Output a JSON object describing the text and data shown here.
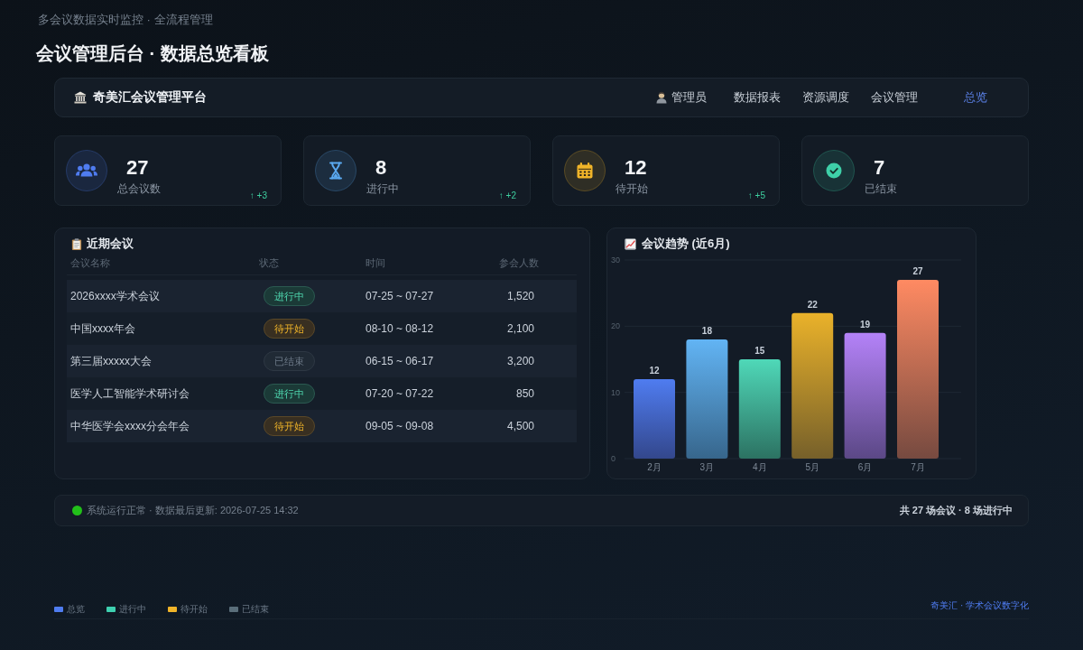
{
  "header": {
    "subtitle": "多会议数据实时监控 · 全流程管理",
    "title": "会议管理后台 · 数据总览看板"
  },
  "navbar": {
    "brand": "奇美汇会议管理平台",
    "items": [
      {
        "label": "管理员",
        "kind": "user",
        "selected": false
      },
      {
        "label": "数据报表",
        "kind": "link",
        "selected": false
      },
      {
        "label": "资源调度",
        "kind": "link",
        "selected": false
      },
      {
        "label": "会议管理",
        "kind": "link",
        "selected": false
      },
      {
        "label": "总览",
        "kind": "link",
        "selected": true
      }
    ]
  },
  "stats": [
    {
      "value": "27",
      "label": "总会议数",
      "trend": "↑ +3",
      "color": "#4f7cf0"
    },
    {
      "value": "8",
      "label": "进行中",
      "trend": "↑ +2",
      "color": "#5aa9f0"
    },
    {
      "value": "12",
      "label": "待开始",
      "trend": "↑ +5",
      "color": "#f0b429"
    },
    {
      "value": "7",
      "label": "已结束",
      "color": "#3ed0a8"
    }
  ],
  "recent_meetings": {
    "title": "近期会议",
    "columns": [
      "会议名称",
      "状态",
      "时间",
      "参会人数"
    ],
    "rows": [
      {
        "name": "2026xxxx学术会议",
        "status": {
          "label": "进行中",
          "kind": "ongoing"
        },
        "time": "07-25 ~ 07-27",
        "attendees": "1,520"
      },
      {
        "name": "中国xxxx年会",
        "status": {
          "label": "待开始",
          "kind": "upcoming"
        },
        "time": "08-10 ~ 08-12",
        "attendees": "2,100"
      },
      {
        "name": "第三届xxxxx大会",
        "status": {
          "label": "已结束",
          "kind": "ended"
        },
        "time": "06-15 ~ 06-17",
        "attendees": "3,200"
      },
      {
        "name": "医学人工智能学术研讨会",
        "status": {
          "label": "进行中",
          "kind": "ongoing"
        },
        "time": "07-20 ~ 07-22",
        "attendees": "850"
      },
      {
        "name": "中华医学会xxxx分会年会",
        "status": {
          "label": "待开始",
          "kind": "upcoming"
        },
        "time": "09-05 ~ 09-08",
        "attendees": "4,500"
      }
    ]
  },
  "trend_chart": {
    "chart_data": {
      "type": "bar",
      "title": "会议趋势 (近6月)",
      "categories": [
        "2月",
        "3月",
        "4月",
        "5月",
        "6月",
        "7月"
      ],
      "values": [
        12,
        18,
        15,
        22,
        19,
        27
      ],
      "ylim": [
        0,
        30
      ],
      "yticks": [
        0,
        10,
        20,
        30
      ],
      "data_labels": true
    }
  },
  "status_bar": {
    "healthy": true,
    "text": "系统运行正常 · 数据最后更新: 2026-07-25 14:32",
    "summary": "共 27 场会议 · 8 场进行中"
  },
  "legend": [
    {
      "label": "总览",
      "color": "#4f7cf0"
    },
    {
      "label": "进行中",
      "color": "#3ed0b0"
    },
    {
      "label": "待开始",
      "color": "#f0b429"
    },
    {
      "label": "已结束",
      "color": "#5a6e7a"
    }
  ],
  "footer_brand": "奇美汇 · 学术会议数字化"
}
